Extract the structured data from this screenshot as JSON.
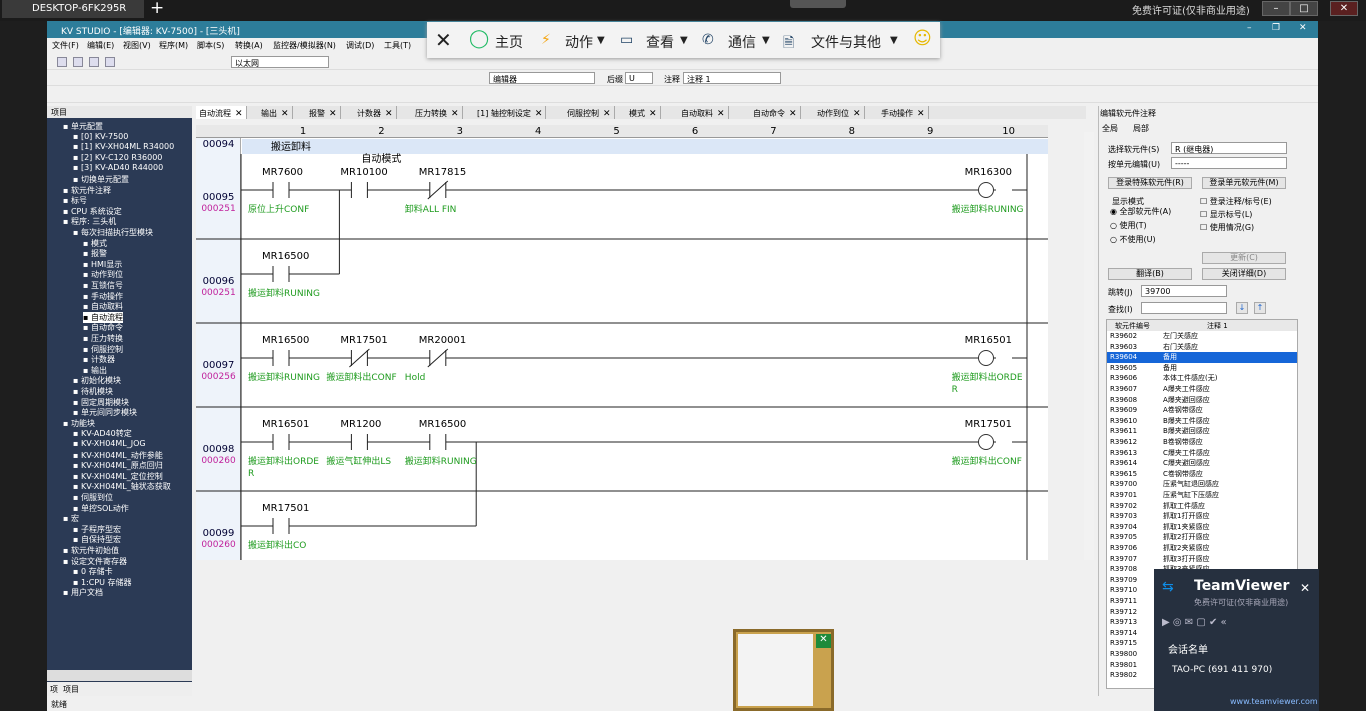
{
  "teamviewer_bar": {
    "tab": "DESKTOP-6FK295R",
    "new": "+",
    "license": "免费许可证(仅非商业用途)"
  },
  "app": {
    "title": "KV STUDIO - [编辑器: KV-7500] - [三头机]"
  },
  "menu": [
    "文件(F)",
    "编辑(E)",
    "视图(V)",
    "程序(M)",
    "脚本(S)",
    "转换(A)",
    "监控器/模拟器(N)",
    "调试(D)",
    "工具(T)"
  ],
  "toolbar": {
    "combo1": "以太网",
    "combo2": "编辑器",
    "combo3": "后缀",
    "combo4": "U",
    "combo5": "注释",
    "combo6": "注释 1"
  },
  "tv_panel": {
    "close": "✕",
    "home": "主页",
    "actions": "动作",
    "view": "查看",
    "comm": "通信",
    "files": "文件与其他",
    "smile": "☺"
  },
  "left_panel": {
    "title": "项目",
    "tab_a": "项",
    "tab_b": "项目",
    "nodes": [
      "单元配置",
      "[0] KV-7500",
      "[1] KV-XH04ML  R34000",
      "[2] KV-C120  R36000",
      "[3] KV-AD40  R44000",
      "切换单元配置",
      "软元件注释",
      "标号",
      "CPU 系统设定",
      "程序: 三头机",
      "每次扫描执行型模块",
      "模式",
      "报警",
      "HMI显示",
      "动作到位",
      "互锁信号",
      "手动操作",
      "自动取料",
      "自动流程",
      "自动命令",
      "压力转换",
      "伺服控制",
      "计数器",
      "输出",
      "初始化模块",
      "待机模块",
      "固定周期模块",
      "单元间同步模块",
      "功能块",
      "KV-AD40转定",
      "KV-XH04ML_JOG",
      "KV-XH04ML_动作参能",
      "KV-XH04ML_原点回归",
      "KV-XH04ML_定位控制",
      "KV-XH04ML_轴状态获取",
      "伺服到位",
      "单控SOL动作",
      "宏",
      "子程序型宏",
      "自保持型宏",
      "软元件初始值",
      "设定文件寄存器",
      "0 存储卡",
      "1:CPU 存储器",
      "用户文档"
    ]
  },
  "tabs": [
    "自动流程",
    "输出",
    "报警",
    "计数器",
    "压力转换",
    "[1] 轴控制设定",
    "伺服控制",
    "模式",
    "自动取料",
    "自动命令",
    "动作到位",
    "手动操作"
  ],
  "columns": [
    "1",
    "2",
    "3",
    "4",
    "5",
    "6",
    "7",
    "8",
    "9",
    "10"
  ],
  "ladder": {
    "r0": {
      "num": "00094",
      "title": "搬运卸料"
    },
    "r1": {
      "num": "00095",
      "addr": "000251",
      "note": "自动模式",
      "c1": "MR7600",
      "c2": "MR10100",
      "c3": "MR17815",
      "coil": "MR16300",
      "m1": "原位上升CONF",
      "m3": "卸料ALL FIN",
      "mcoil": "搬运卸料RUNING"
    },
    "r2": {
      "num": "00096",
      "addr": "000251",
      "c1": "MR16500",
      "m1": "搬运卸料RUNING"
    },
    "r3": {
      "num": "00097",
      "addr": "000256",
      "c1": "MR16500",
      "c2": "MR17501",
      "c3": "MR20001",
      "coil": "MR16501",
      "m1": "搬运卸料RUNING",
      "m2": "搬运卸料出CONF",
      "m3": "Hold",
      "mcoil": "搬运卸料出ORDER"
    },
    "r4": {
      "num": "00098",
      "addr": "000260",
      "c1": "MR16501",
      "c2": "MR1200",
      "c3": "MR16500",
      "coil": "MR17501",
      "m1": "搬运卸料出ORDER",
      "m2": "搬运气缸伸出LS",
      "m3": "搬运卸料RUNING",
      "mcoil": "搬运卸料出CONF"
    },
    "r5": {
      "num": "00099",
      "addr": "000260",
      "c1": "MR17501",
      "m1": "搬运卸料出CO"
    }
  },
  "right_panel": {
    "title": "编辑软元件注释",
    "tab1": "全局",
    "tab2": "局部",
    "sel_label": "选择软元件(S)",
    "sel_value": "R (继电器)",
    "unit_label": "按单元编辑(U)",
    "unit_value": "-----",
    "btn_special": "登录特殊软元件(R)",
    "btn_unit": "登录单元软元件(M)",
    "display_mode": "显示模式",
    "radio_all": "全部软元件(A)",
    "radio_used": "使用(T)",
    "radio_unused": "不使用(U)",
    "chk_reg": "登录注释/标号(E)",
    "chk_label": "显示标号(L)",
    "chk_usage": "使用情况(G)",
    "btn_update": "更新(C)",
    "btn_translate": "翻译(B)",
    "btn_close": "关闭详细(D)",
    "jump_label": "跳转(J)",
    "jump_value": "39700",
    "find_label": "查找(I)",
    "col_code": "软元件编号",
    "col_comment": "注释 1",
    "rows": [
      [
        "R39602",
        "左门关感应"
      ],
      [
        "R39603",
        "右门关感应"
      ],
      [
        "R39604",
        "备用"
      ],
      [
        "R39605",
        "备用"
      ],
      [
        "R39606",
        "本体工件感应(无)"
      ],
      [
        "R39607",
        "A爆夹工件感应"
      ],
      [
        "R39608",
        "A爆夹避回感应"
      ],
      [
        "R39609",
        "A卷钢带感应"
      ],
      [
        "R39610",
        "B爆夹工件感应"
      ],
      [
        "R39611",
        "B爆夹避回感应"
      ],
      [
        "R39612",
        "B卷钢带感应"
      ],
      [
        "R39613",
        "C爆夹工件感应"
      ],
      [
        "R39614",
        "C爆夹避回感应"
      ],
      [
        "R39615",
        "C卷钢带感应"
      ],
      [
        "R39700",
        "压紧气缸退回感应"
      ],
      [
        "R39701",
        "压紧气缸下压感应"
      ],
      [
        "R39702",
        "抓取工件感应"
      ],
      [
        "R39703",
        "抓取1打开感应"
      ],
      [
        "R39704",
        "抓取1夹紧感应"
      ],
      [
        "R39705",
        "抓取2打开感应"
      ],
      [
        "R39706",
        "抓取2夹紧感应"
      ],
      [
        "R39707",
        "抓取3打开感应"
      ],
      [
        "R39708",
        "抓取3夹紧感应"
      ],
      [
        "R39709",
        ""
      ],
      [
        "R39710",
        ""
      ],
      [
        "R39711",
        ""
      ],
      [
        "R39712",
        ""
      ],
      [
        "R39713",
        ""
      ],
      [
        "R39714",
        ""
      ],
      [
        "R39715",
        ""
      ],
      [
        "R39800",
        ""
      ],
      [
        "R39801",
        ""
      ],
      [
        "R39802",
        ""
      ]
    ]
  },
  "teamviewer": {
    "brand": "TeamViewer",
    "sub": "免费许可证(仅非商业用途)",
    "session": "会话名单",
    "peer": "TAO-PC (691 411 970)",
    "url": "www.teamviewer.com"
  },
  "status": "就绪"
}
